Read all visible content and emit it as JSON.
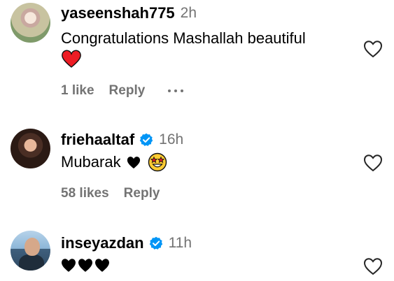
{
  "comments": [
    {
      "username": "yaseenshah775",
      "time": "2h",
      "verified": false,
      "text": "Congratulations Mashallah beautiful",
      "emoji_line": "red-heart",
      "likes": "1 like",
      "reply": "Reply",
      "has_more": true
    },
    {
      "username": "friehaaltaf",
      "time": "16h",
      "verified": true,
      "text": "Mubarak",
      "emoji_inline": [
        "black-heart",
        "star-struck"
      ],
      "likes": "58 likes",
      "reply": "Reply"
    },
    {
      "username": "inseyazdan",
      "time": "11h",
      "verified": true,
      "emoji_inline": [
        "black-heart",
        "black-heart",
        "black-heart"
      ]
    }
  ],
  "colors": {
    "meta_gray": "#737373",
    "verified_blue": "#0095f6",
    "heart_red": "#ed1c24"
  }
}
